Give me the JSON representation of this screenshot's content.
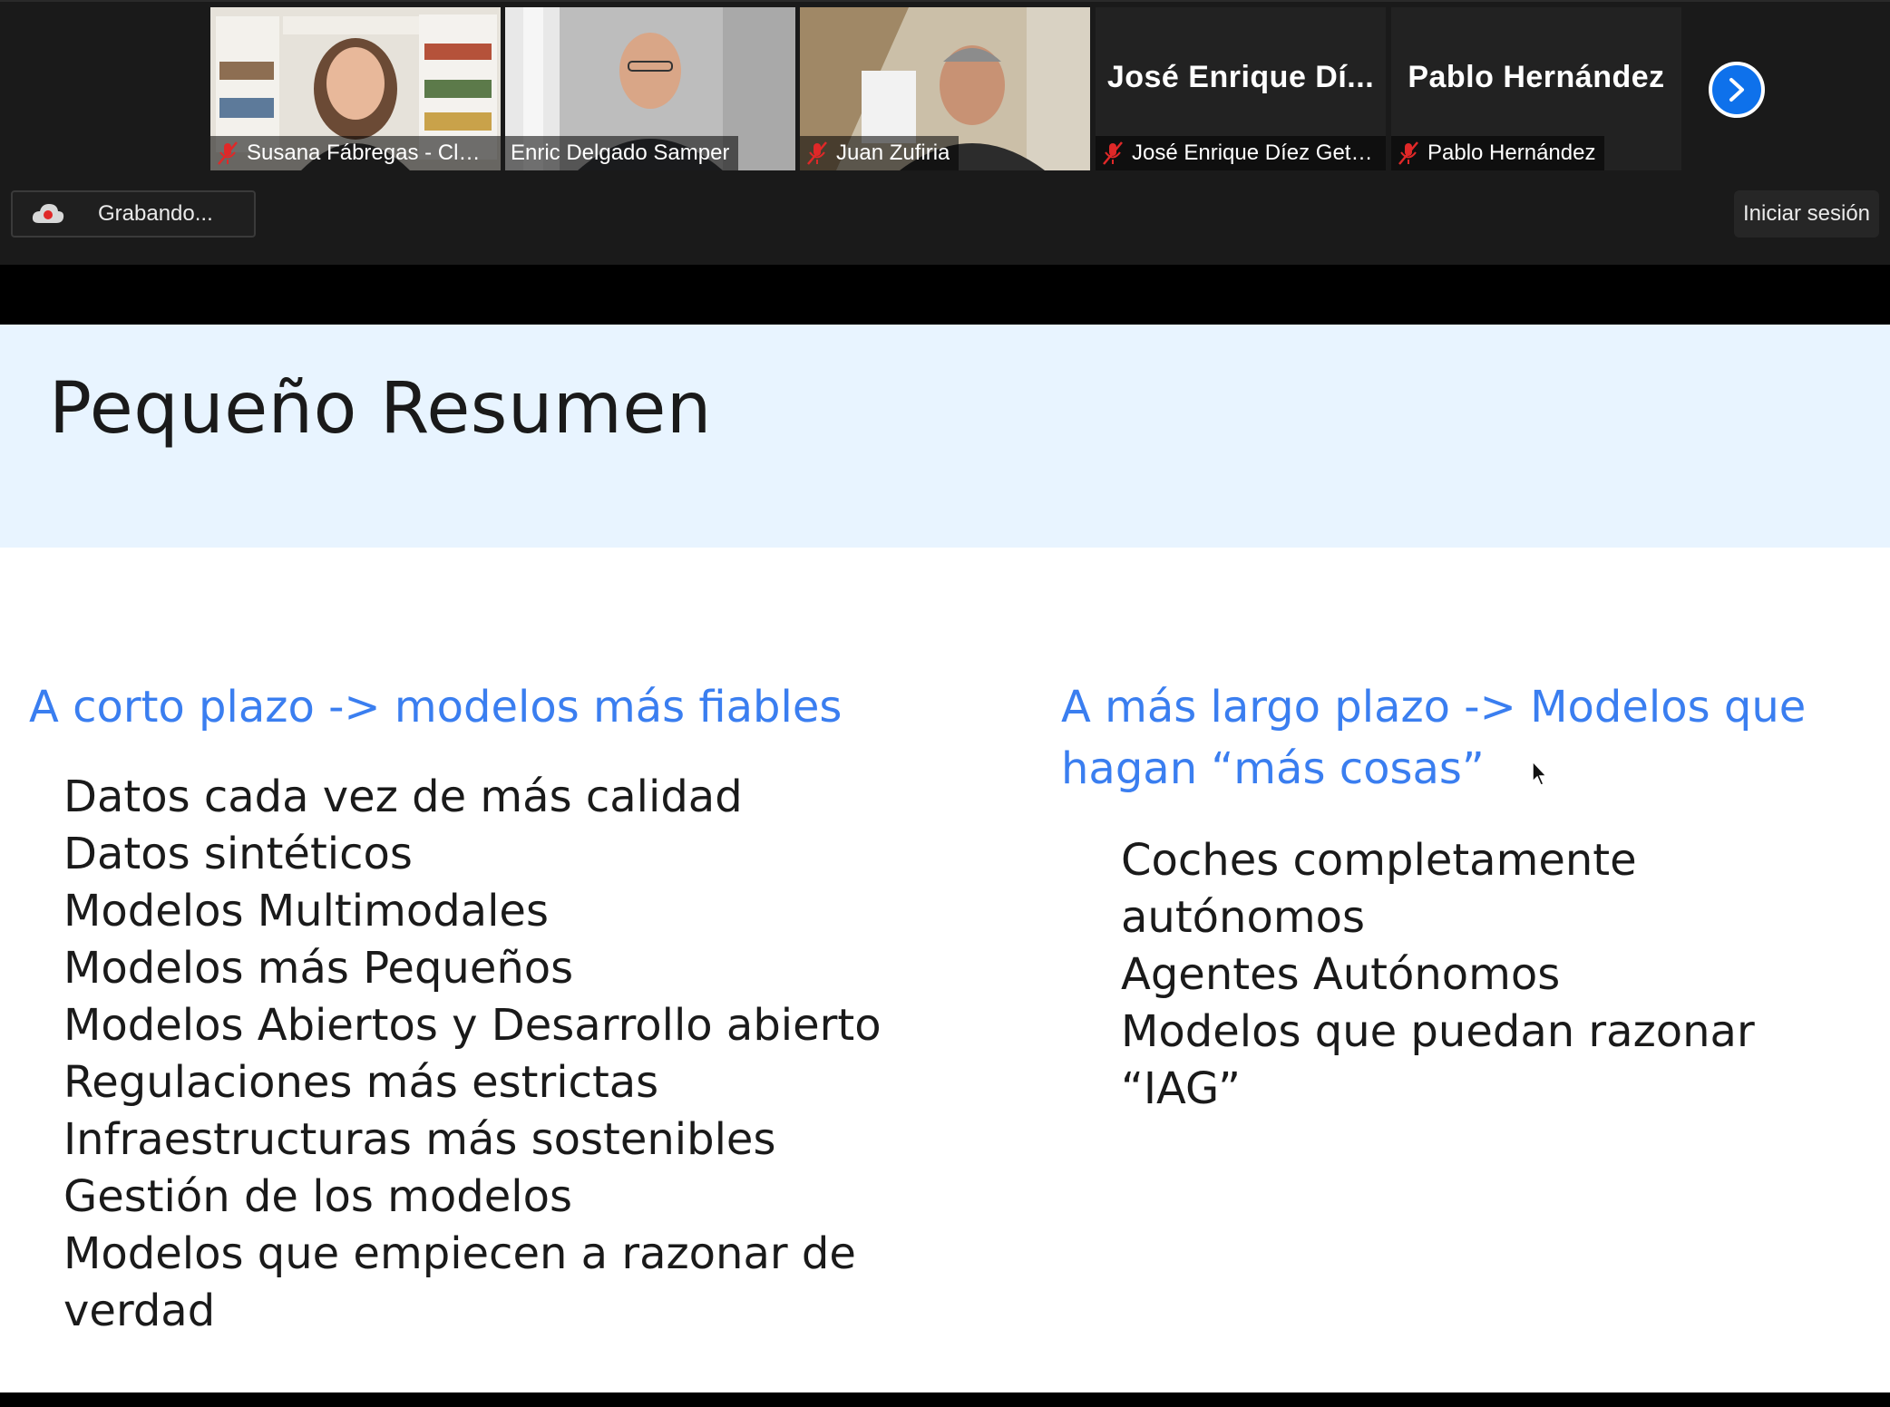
{
  "participants": [
    {
      "name": "Susana Fábregas - Club...",
      "muted": true,
      "video": true
    },
    {
      "name": "Enric Delgado Samper",
      "muted": false,
      "video": true,
      "active_speaker": true
    },
    {
      "name": "Juan Zufiria",
      "muted": true,
      "video": true
    },
    {
      "name": "José Enrique Díez Getino",
      "display_name": "José Enrique Dí...",
      "muted": true,
      "video": false
    },
    {
      "name": "Pablo Hernández",
      "display_name": "Pablo Hernández",
      "muted": true,
      "video": false
    }
  ],
  "toolbar": {
    "recording_label": "Grabando...",
    "signin_label": "Iniciar sesión"
  },
  "slide": {
    "title": "Pequeño Resumen",
    "short_term": {
      "heading": "A corto plazo -> modelos más fiables",
      "items": [
        "Datos cada vez de más calidad",
        "Datos sintéticos",
        "Modelos Multimodales",
        "Modelos más Pequeños",
        "Modelos Abiertos y Desarrollo abierto",
        "Regulaciones más estrictas",
        "Infraestructuras más sostenibles",
        "Gestión de los modelos",
        "Modelos que empiecen a razonar de",
        "verdad"
      ]
    },
    "long_term": {
      "heading_line1": "A más largo plazo -> Modelos que",
      "heading_line2": "hagan “más cosas”",
      "items": [
        "Coches completamente autónomos",
        "Agentes Autónomos",
        "Modelos que puedan razonar",
        "“IAG”"
      ]
    }
  },
  "colors": {
    "active_speaker_border": "#8bc34a",
    "next_button": "#0e71eb",
    "slide_header_bg": "#e8f4ff",
    "heading_blue": "#3a7ef0",
    "mic_off_red": "#e02828"
  }
}
